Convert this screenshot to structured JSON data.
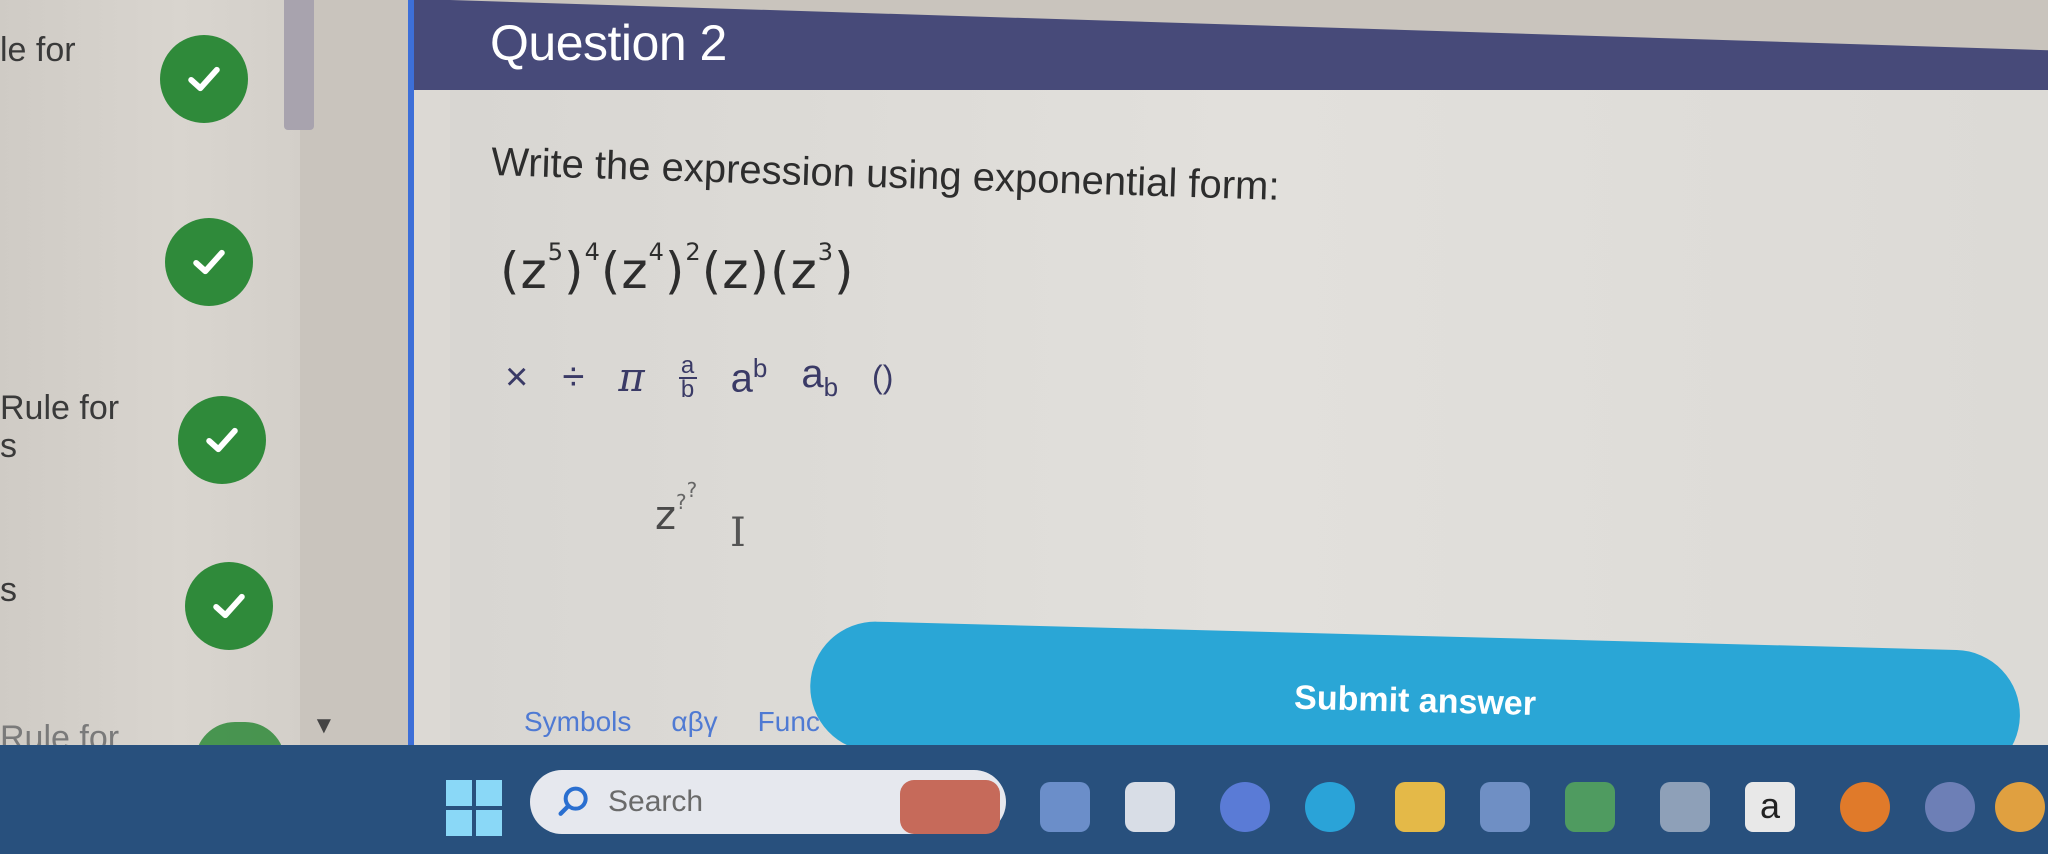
{
  "sidebar": {
    "items": [
      {
        "label_lines": [
          "le for"
        ],
        "completed": true
      },
      {
        "label_lines": [],
        "completed": true
      },
      {
        "label_lines": [
          "Rule for",
          "s"
        ],
        "completed": true
      },
      {
        "label_lines": [
          "s"
        ],
        "completed": true
      },
      {
        "label_lines": [
          "Rule for"
        ],
        "completed": true
      }
    ]
  },
  "question": {
    "title": "Question 2",
    "prompt": "Write the expression using exponential form:",
    "expression_terms": [
      {
        "base": "z",
        "inner_exp": "5",
        "outer_exp": "4"
      },
      {
        "base": "z",
        "inner_exp": "4",
        "outer_exp": "2"
      },
      {
        "base": "z"
      },
      {
        "base": "z",
        "inner_exp": "3"
      }
    ]
  },
  "math_toolbar": {
    "times": "×",
    "divide": "÷",
    "pi": "π",
    "frac_num": "a",
    "frac_den": "b",
    "power_base": "a",
    "power_exp": "b",
    "sub_base": "a",
    "sub_sub": "b",
    "parens": "()"
  },
  "answer": {
    "base": "z",
    "exp_placeholder": "?",
    "exp_exp_placeholder": "?"
  },
  "submit_label": "Submit answer",
  "palette_tabs": [
    "Symbols",
    "αβγ",
    "Func"
  ],
  "taskbar": {
    "search_placeholder": "Search",
    "letter_app": "a"
  },
  "colors": {
    "header": "#474a79",
    "submit": "#2aa6d6",
    "check": "#2f8a3a",
    "taskbar": "#28507d"
  }
}
